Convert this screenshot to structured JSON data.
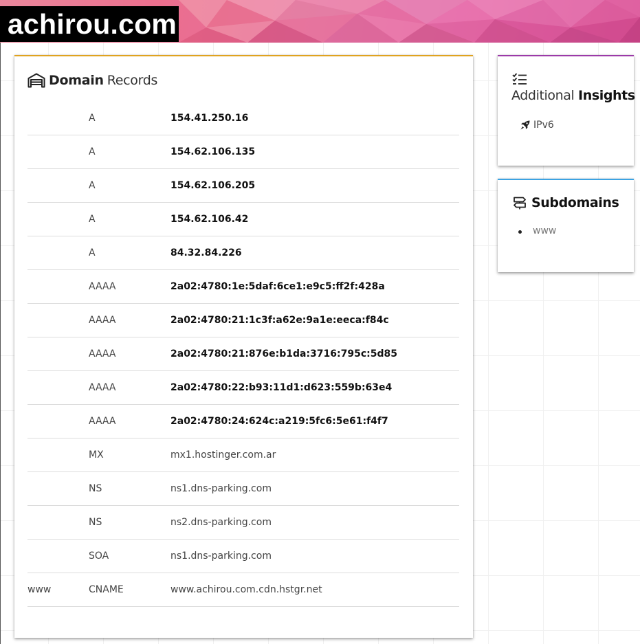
{
  "site": {
    "title": "achirou.com"
  },
  "records_card": {
    "title_bold": "Domain",
    "title_light": "Records",
    "rows": [
      {
        "host": "",
        "type": "A",
        "value": "154.41.250.16",
        "bold": true
      },
      {
        "host": "",
        "type": "A",
        "value": "154.62.106.135",
        "bold": true
      },
      {
        "host": "",
        "type": "A",
        "value": "154.62.106.205",
        "bold": true
      },
      {
        "host": "",
        "type": "A",
        "value": "154.62.106.42",
        "bold": true
      },
      {
        "host": "",
        "type": "A",
        "value": "84.32.84.226",
        "bold": true
      },
      {
        "host": "",
        "type": "AAAA",
        "value": "2a02:4780:1e:5daf:6ce1:e9c5:ff2f:428a",
        "bold": true
      },
      {
        "host": "",
        "type": "AAAA",
        "value": "2a02:4780:21:1c3f:a62e:9a1e:eeca:f84c",
        "bold": true
      },
      {
        "host": "",
        "type": "AAAA",
        "value": "2a02:4780:21:876e:b1da:3716:795c:5d85",
        "bold": true
      },
      {
        "host": "",
        "type": "AAAA",
        "value": "2a02:4780:22:b93:11d1:d623:559b:63e4",
        "bold": true
      },
      {
        "host": "",
        "type": "AAAA",
        "value": "2a02:4780:24:624c:a219:5fc6:5e61:f4f7",
        "bold": true
      },
      {
        "host": "",
        "type": "MX",
        "value": "mx1.hostinger.com.ar",
        "bold": false
      },
      {
        "host": "",
        "type": "NS",
        "value": "ns1.dns-parking.com",
        "bold": false
      },
      {
        "host": "",
        "type": "NS",
        "value": "ns2.dns-parking.com",
        "bold": false
      },
      {
        "host": "",
        "type": "SOA",
        "value": "ns1.dns-parking.com",
        "bold": false
      },
      {
        "host": "www",
        "type": "CNAME",
        "value": "www.achirou.com.cdn.hstgr.net",
        "bold": false
      }
    ]
  },
  "insights_card": {
    "title_light": "Additional",
    "title_bold": "Insights",
    "items": [
      {
        "label": "IPv6",
        "icon": "rocket-icon"
      }
    ]
  },
  "subdomains_card": {
    "title": "Subdomains",
    "items": [
      "www"
    ]
  },
  "colors": {
    "records_accent": "#e0a320",
    "insights_accent": "#9b3aa8",
    "subdomains_accent": "#3ba3e3"
  }
}
